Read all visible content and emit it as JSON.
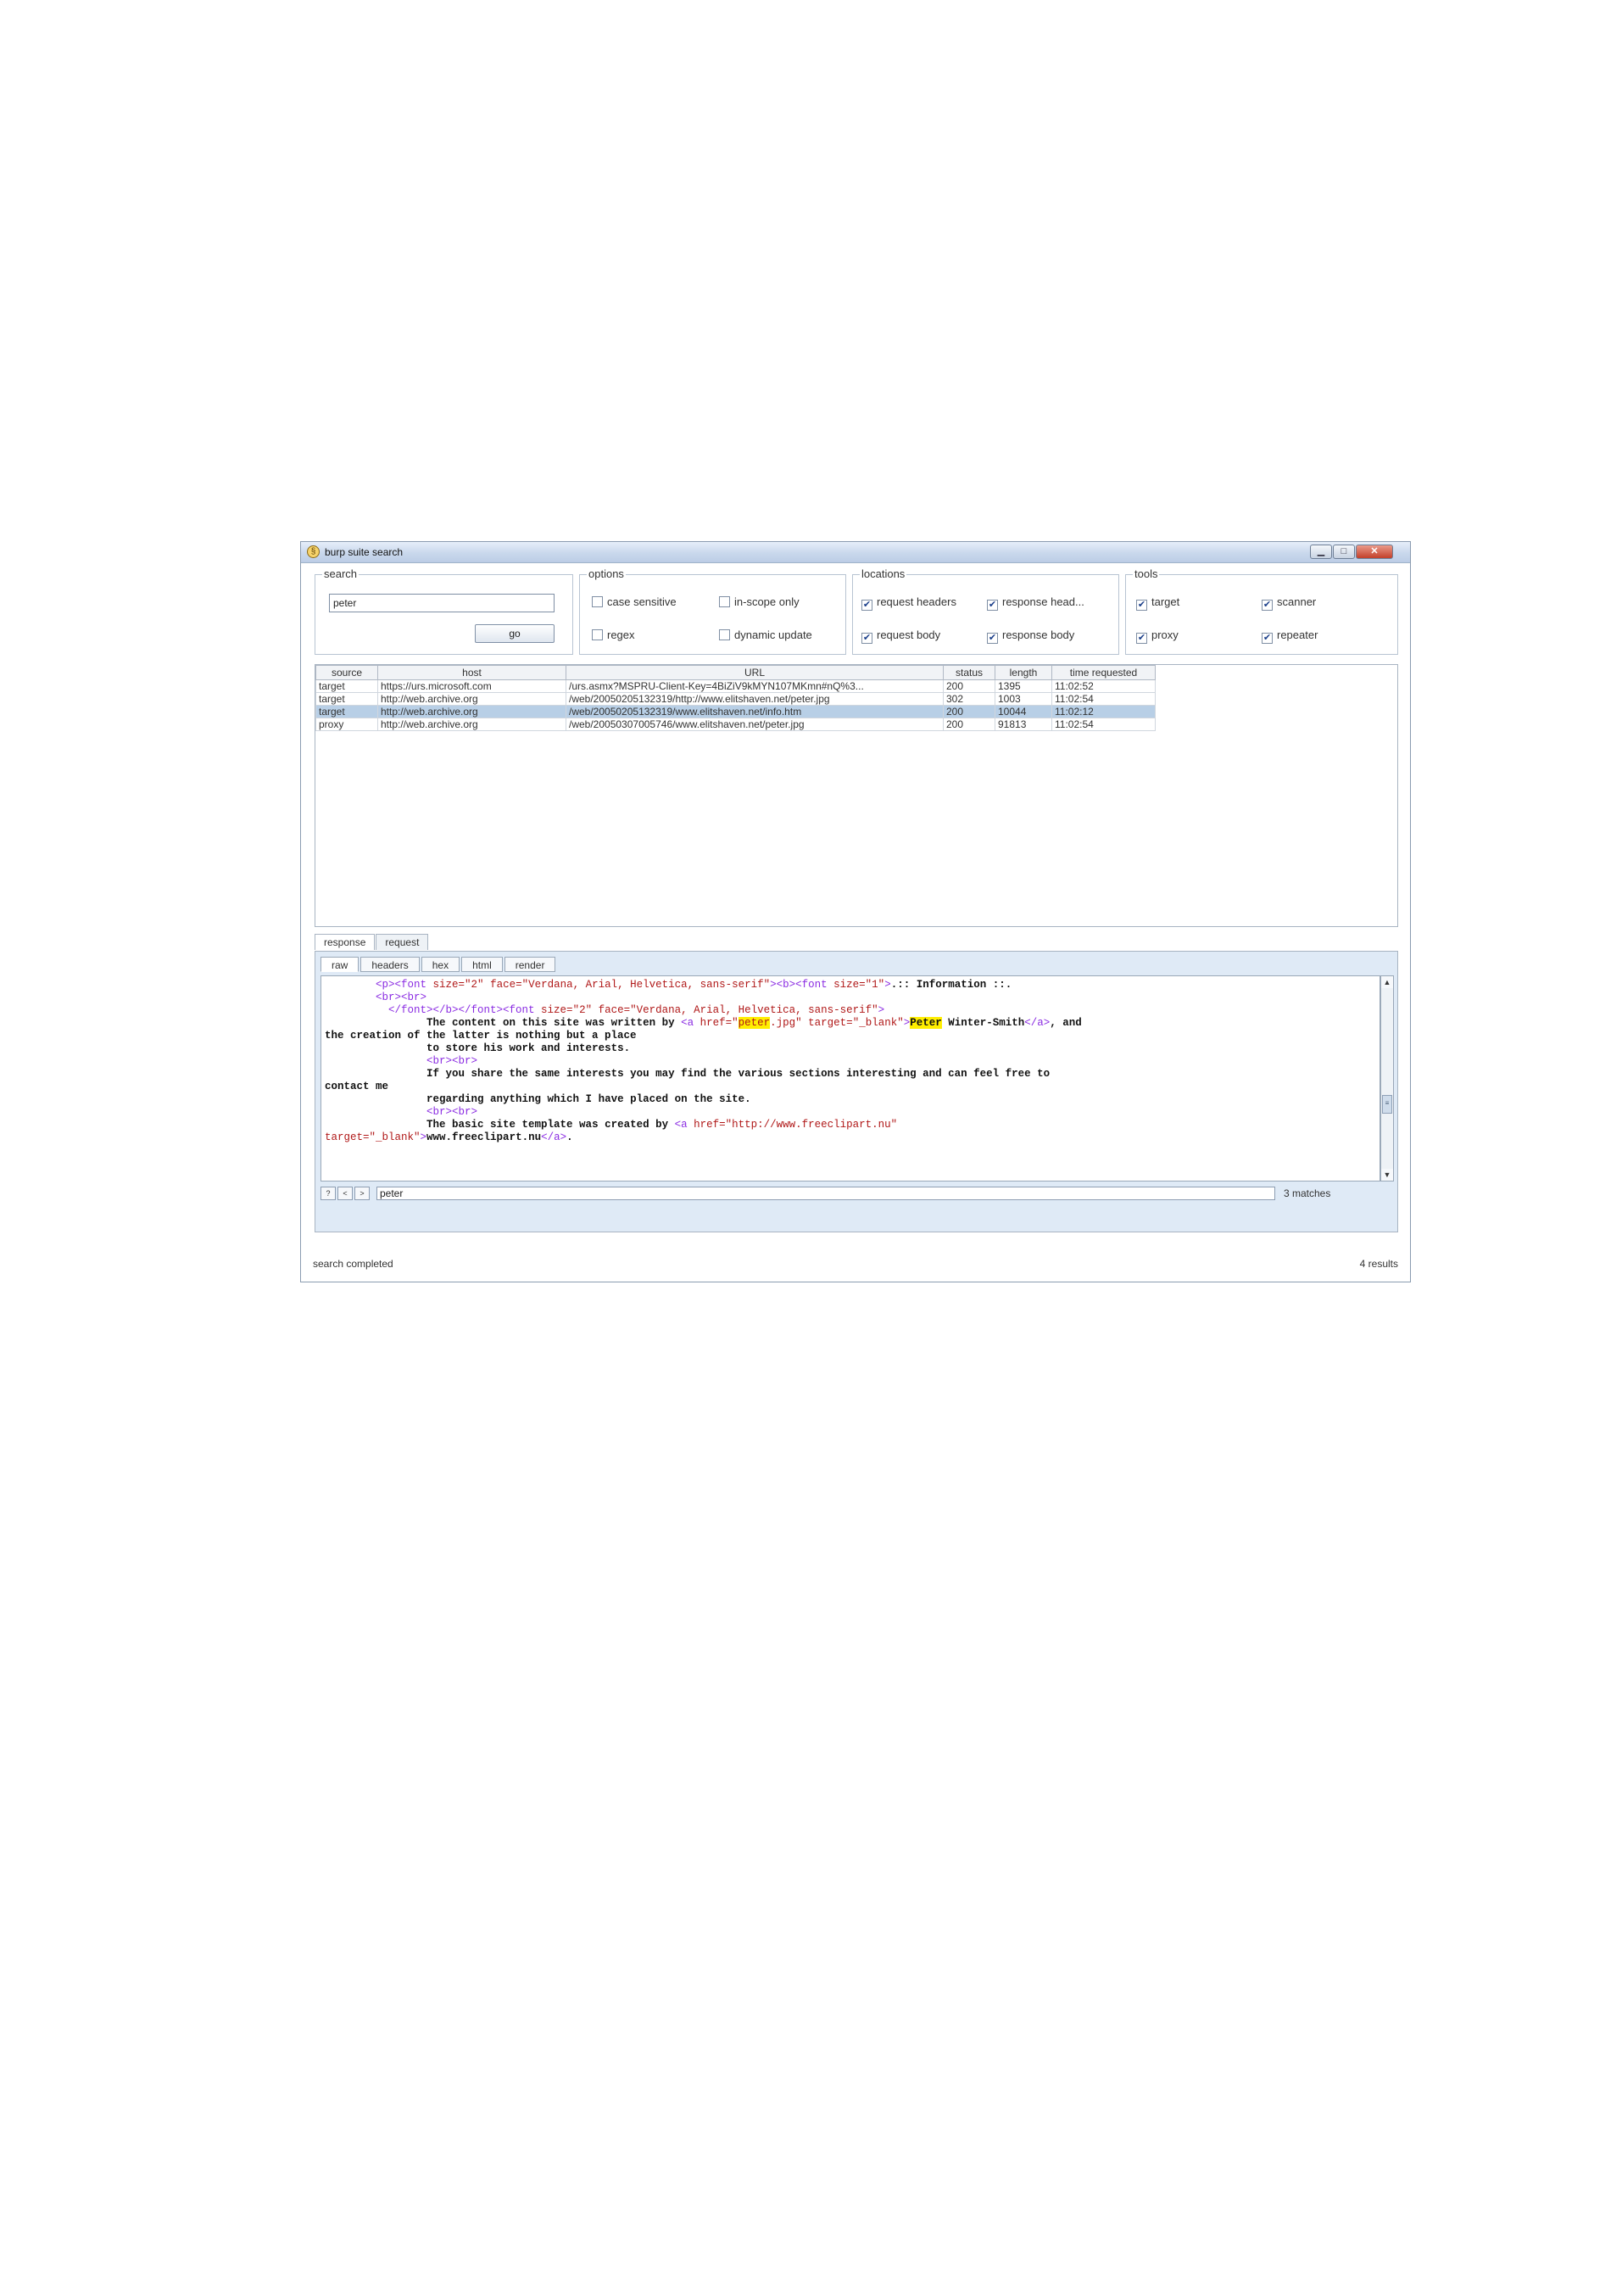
{
  "window": {
    "title": "burp suite search",
    "app_icon": "burp-logo-icon"
  },
  "search": {
    "title": "search",
    "query": "peter",
    "go_label": "go"
  },
  "options": {
    "title": "options",
    "items": [
      {
        "label": "case sensitive",
        "checked": false
      },
      {
        "label": "in-scope only",
        "checked": false
      },
      {
        "label": "regex",
        "checked": false
      },
      {
        "label": "dynamic update",
        "checked": false
      }
    ]
  },
  "locations": {
    "title": "locations",
    "items": [
      {
        "label": "request headers",
        "checked": true
      },
      {
        "label": "response head...",
        "checked": true
      },
      {
        "label": "request body",
        "checked": true
      },
      {
        "label": "response body",
        "checked": true
      }
    ]
  },
  "tools": {
    "title": "tools",
    "items": [
      {
        "label": "target",
        "checked": true
      },
      {
        "label": "scanner",
        "checked": true
      },
      {
        "label": "proxy",
        "checked": true
      },
      {
        "label": "repeater",
        "checked": true
      }
    ]
  },
  "results": {
    "columns": [
      "source",
      "host",
      "URL",
      "status",
      "length",
      "time requested"
    ],
    "rows": [
      [
        "target",
        "https://urs.microsoft.com",
        "/urs.asmx?MSPRU-Client-Key=4BiZiV9kMYN107MKmn#nQ%3...",
        "200",
        "1395",
        "11:02:52"
      ],
      [
        "target",
        "http://web.archive.org",
        "/web/20050205132319/http://www.elitshaven.net/peter.jpg",
        "302",
        "1003",
        "11:02:54"
      ],
      [
        "target",
        "http://web.archive.org",
        "/web/20050205132319/www.elitshaven.net/info.htm",
        "200",
        "10044",
        "11:02:12"
      ],
      [
        "proxy",
        "http://web.archive.org",
        "/web/20050307005746/www.elitshaven.net/peter.jpg",
        "200",
        "91813",
        "11:02:54"
      ]
    ],
    "selected_row": 2
  },
  "tabs": [
    "response",
    "request"
  ],
  "subtabs": [
    "raw",
    "headers",
    "hex",
    "html",
    "render"
  ],
  "code": {
    "lines": [
      {
        "a": "",
        "b": ""
      }
    ],
    "l1_tag1": "<p><font ",
    "l1_a1": "size=",
    "l1_v1": "\"2\" ",
    "l1_a2": "face=",
    "l1_v2": "\"Verdana, Arial, Helvetica, sans-serif\"",
    "l1_tag2": "><b><font ",
    "l1_a3": "size=",
    "l1_v3": "\"1\"",
    "l1_tag3": ">",
    "l1_text": ".:: Information ::.",
    "l2_tag": "<br><br>",
    "l3_tag1": "</font></b></font><font ",
    "l3_a1": "size=",
    "l3_v1": "\"2\" ",
    "l3_a2": "face=",
    "l3_v2": "\"Verdana, Arial, Helvetica, sans-serif\"",
    "l3_tag2": ">",
    "l4_text": "The content on this site was written by ",
    "l4_tag1": "<a ",
    "l4_a1": "href=",
    "l4_q1": "\"",
    "l4_hl1": "peter",
    "l4_q2": ".jpg\" ",
    "l4_a2": "target=",
    "l4_v2": "\"_blank\"",
    "l4_tag2": ">",
    "l4_hl2": "Peter",
    "l4_text2": " Winter-Smith",
    "l4_tag3": "</a>",
    "l4_text3": ", and",
    "l5_text": "the creation of the latter is nothing but a place",
    "l6_text": "to store his work and interests.",
    "l7_tag": "<br><br>",
    "l8_text": "If you share the same interests you may find the various sections interesting and can feel free to",
    "l9_text": "contact me",
    "l10_text": "regarding anything which I have placed on the site.",
    "l11_tag": "<br><br>",
    "l12_text": "The basic site template was created by ",
    "l12_tag": "<a ",
    "l12_a": "href=",
    "l12_v": "\"http://www.freeclipart.nu\"",
    "l13_a": "target=",
    "l13_v": "\"_blank\"",
    "l13_tag": ">",
    "l13_text": "www.freeclipart.nu",
    "l13_tag2": "</a>",
    "l13_text2": "."
  },
  "find": {
    "query": "peter",
    "matches": "3 matches"
  },
  "status": {
    "left": "search completed",
    "right": "4 results"
  }
}
